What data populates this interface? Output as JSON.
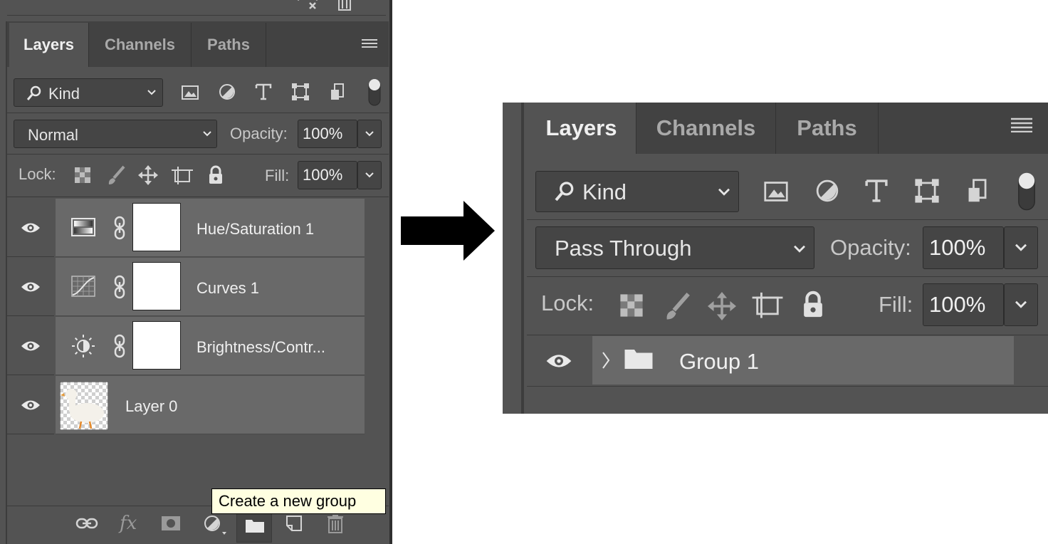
{
  "left_panel": {
    "tabs": [
      {
        "label": "Layers",
        "active": true
      },
      {
        "label": "Channels",
        "active": false
      },
      {
        "label": "Paths",
        "active": false
      }
    ],
    "filter": {
      "label": "Kind"
    },
    "blend_mode": "Normal",
    "opacity_label": "Opacity:",
    "opacity_value": "100%",
    "lock_label": "Lock:",
    "fill_label": "Fill:",
    "fill_value": "100%",
    "layers": [
      {
        "name": "Hue/Saturation 1",
        "icon": "hue-saturation-icon"
      },
      {
        "name": "Curves 1",
        "icon": "curves-icon"
      },
      {
        "name": "Brightness/Contr...",
        "icon": "brightness-icon"
      },
      {
        "name": "Layer 0",
        "icon": "duck-thumbnail"
      }
    ],
    "tooltip": "Create a new group",
    "footer_icons": [
      "link-icon",
      "fx-icon",
      "mask-icon",
      "adjustment-icon",
      "folder-icon",
      "new-layer-icon",
      "trash-icon"
    ]
  },
  "right_panel": {
    "tabs": [
      {
        "label": "Layers",
        "active": true
      },
      {
        "label": "Channels",
        "active": false
      },
      {
        "label": "Paths",
        "active": false
      }
    ],
    "filter": {
      "label": "Kind"
    },
    "blend_mode": "Pass Through",
    "opacity_label": "Opacity:",
    "opacity_value": "100%",
    "lock_label": "Lock:",
    "fill_label": "Fill:",
    "fill_value": "100%",
    "group": {
      "name": "Group 1"
    }
  },
  "colors": {
    "panel_bg": "#535353",
    "tab_bar_bg": "#424242",
    "layer_row_bg": "#696969",
    "tooltip_bg": "#ffffe1"
  }
}
